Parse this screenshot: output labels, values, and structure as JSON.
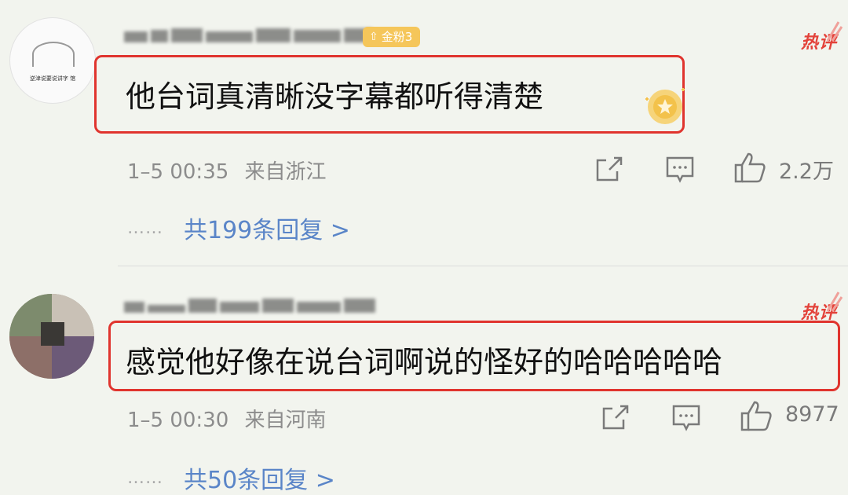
{
  "comments": [
    {
      "badge": "金粉3",
      "hot_label": "热评",
      "avatar_text": "逆津说要说讲字 馆",
      "text": "他台词真清晰没字幕都听得清楚",
      "time": "1–5 00:35",
      "location": "来自浙江",
      "likes": "2.2万",
      "replies": "共199条回复 >"
    },
    {
      "hot_label": "热评",
      "text": "感觉他好像在说台词啊说的怪好的哈哈哈哈哈",
      "time": "1–5 00:30",
      "location": "来自河南",
      "likes": "8977",
      "replies": "共50条回复 >"
    }
  ],
  "icons": [
    "share-icon",
    "comment-icon",
    "like-icon"
  ],
  "colors": {
    "highlight_border": "#e0342e",
    "reply_link": "#5a85c8",
    "hot_label": "#e3423a",
    "badge": "#f5c65a"
  }
}
